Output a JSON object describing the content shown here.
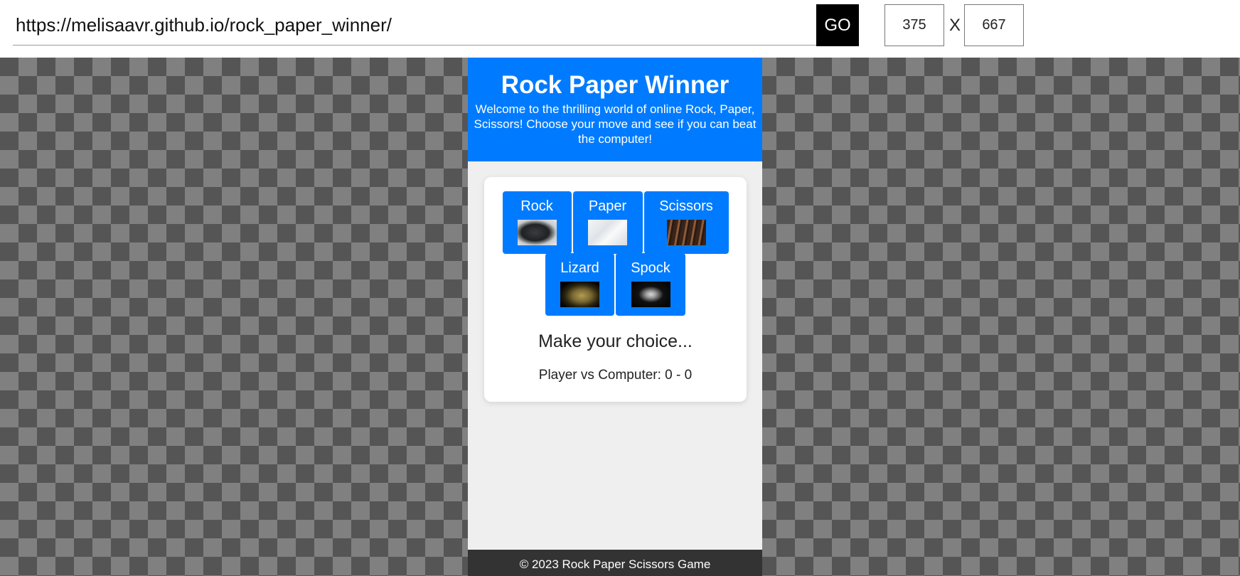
{
  "toolbar": {
    "url": "https://melisaavr.github.io/rock_paper_winner/",
    "go_label": "GO",
    "width_value": "375",
    "separator": "X",
    "height_value": "667"
  },
  "site": {
    "title": "Rock Paper Winner",
    "intro": "Welcome to the thrilling world of online Rock, Paper, Scissors! Choose your move and see if you can beat the computer!",
    "header_color": "#007bff",
    "choices": [
      {
        "label": "Rock",
        "icon": "rock-image"
      },
      {
        "label": "Paper",
        "icon": "paper-image"
      },
      {
        "label": "Scissors",
        "icon": "scissors-image"
      },
      {
        "label": "Lizard",
        "icon": "lizard-image"
      },
      {
        "label": "Spock",
        "icon": "spock-hand-image"
      }
    ],
    "status": "Make your choice...",
    "score": "Player vs Computer: 0 - 0",
    "footer": "© 2023 Rock Paper Scissors Game"
  }
}
